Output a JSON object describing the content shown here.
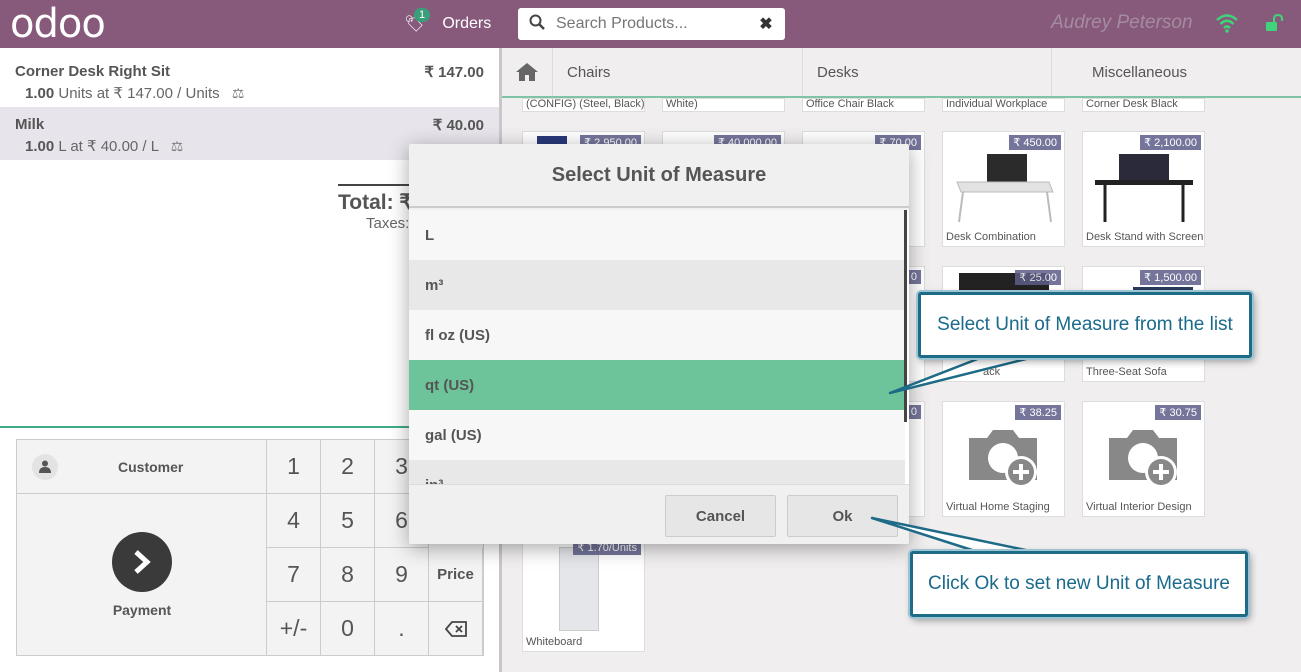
{
  "header": {
    "logo": "odoo",
    "orders_label": "Orders",
    "orders_count": "1",
    "search_placeholder": "Search Products...",
    "user_name": "Audrey Peterson"
  },
  "order": {
    "lines": [
      {
        "name": "Corner Desk Right Sit",
        "price": "₹ 147.00",
        "qty": "1.00",
        "detail": "Units at ₹ 147.00 / Units"
      },
      {
        "name": "Milk",
        "price": "₹ 40.00",
        "qty": "1.00",
        "detail": "L at ₹ 40.00 / L"
      }
    ],
    "total_label": "Total: ₹",
    "taxes_label": "Taxes:"
  },
  "pad": {
    "customer_label": "Customer",
    "payment_label": "Payment",
    "keys": [
      "1",
      "2",
      "3",
      "4",
      "5",
      "6",
      "7",
      "8",
      "9",
      "Price",
      "+/-",
      "0",
      "."
    ]
  },
  "categories": [
    "Chairs",
    "Desks",
    "Miscellaneous"
  ],
  "products": {
    "row0": [
      "(CONFIG) (Steel, Black)",
      "White)",
      "Office Chair Black",
      "Individual Workplace",
      "Corner Desk Black"
    ],
    "row1": [
      {
        "price": "₹ 2,950.00",
        "name": ""
      },
      {
        "price": "₹ 40,000.00",
        "name": ""
      },
      {
        "price": "₹ 70.00",
        "name": ""
      },
      {
        "price": "₹ 450.00",
        "name": "Desk Combination"
      },
      {
        "price": "₹ 2,100.00",
        "name": "Desk Stand with Screen"
      }
    ],
    "row2": [
      {
        "price": "₹ 25.00",
        "name": ""
      },
      {
        "price": "₹ 1,500.00",
        "name": "Three-Seat Sofa"
      },
      {
        "price": "0",
        "name": ""
      },
      {
        "price": "",
        "name": "ack"
      }
    ],
    "row3": [
      {
        "price": "₹ 38.25",
        "name": "Virtual Home Staging"
      },
      {
        "price": "₹ 30.75",
        "name": "Virtual Interior Design"
      },
      {
        "price": "0",
        "name": ""
      }
    ],
    "row4": [
      {
        "price": "₹ 1.70/Units",
        "name": "Whiteboard"
      }
    ]
  },
  "modal": {
    "title": "Select Unit of Measure",
    "items": [
      "L",
      "m³",
      "fl oz (US)",
      "qt (US)",
      "gal (US)",
      "in³"
    ],
    "selected": "qt (US)",
    "cancel_label": "Cancel",
    "ok_label": "Ok"
  },
  "tips": {
    "select_tip": "Select Unit of Measure from the list",
    "ok_tip": "Click Ok to set new Unit of Measure"
  },
  "colors": {
    "header": "#875a7b",
    "accent": "#3fab87",
    "selected_row": "#6ec49a",
    "tip_border": "#1e6b87"
  }
}
